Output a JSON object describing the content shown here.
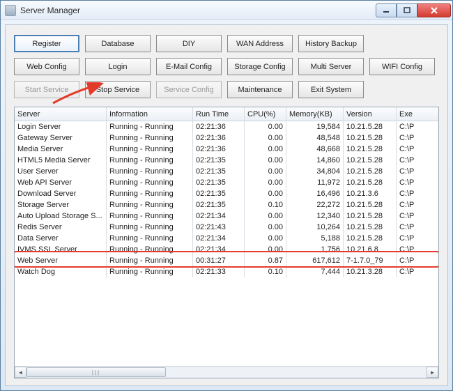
{
  "window": {
    "title": "Server Manager"
  },
  "buttons": {
    "row1": [
      "Register",
      "Database",
      "DIY",
      "WAN Address",
      "History Backup"
    ],
    "row2": [
      "Web Config",
      "Login",
      "E-Mail Config",
      "Storage Config",
      "Multi Server",
      "WIFI Config"
    ],
    "row3": [
      "Start Service",
      "Stop Service",
      "Service Config",
      "Maintenance",
      "Exit System"
    ]
  },
  "button_states": {
    "primary": [
      0
    ],
    "disabled_row3": [
      0,
      2
    ]
  },
  "table": {
    "headers": [
      "Server",
      "Information",
      "Run Time",
      "CPU(%)",
      "Memory(KB)",
      "Version",
      "Exe"
    ],
    "rows": [
      {
        "server": "Login Server",
        "info": "Running - Running",
        "runtime": "02:21:36",
        "cpu": "0.00",
        "mem": "19,584",
        "ver": "10.21.5.28",
        "exe": "C:\\P"
      },
      {
        "server": "Gateway Server",
        "info": "Running - Running",
        "runtime": "02:21:36",
        "cpu": "0.00",
        "mem": "48,548",
        "ver": "10.21.5.28",
        "exe": "C:\\P"
      },
      {
        "server": "Media Server",
        "info": "Running - Running",
        "runtime": "02:21:36",
        "cpu": "0.00",
        "mem": "48,668",
        "ver": "10.21.5.28",
        "exe": "C:\\P"
      },
      {
        "server": "HTML5 Media Server",
        "info": "Running - Running",
        "runtime": "02:21:35",
        "cpu": "0.00",
        "mem": "14,860",
        "ver": "10.21.5.28",
        "exe": "C:\\P"
      },
      {
        "server": "User Server",
        "info": "Running - Running",
        "runtime": "02:21:35",
        "cpu": "0.00",
        "mem": "34,804",
        "ver": "10.21.5.28",
        "exe": "C:\\P"
      },
      {
        "server": "Web API Server",
        "info": "Running - Running",
        "runtime": "02:21:35",
        "cpu": "0.00",
        "mem": "11,972",
        "ver": "10.21.5.28",
        "exe": "C:\\P"
      },
      {
        "server": "Download Server",
        "info": "Running - Running",
        "runtime": "02:21:35",
        "cpu": "0.00",
        "mem": "16,496",
        "ver": "10.21.3.6",
        "exe": "C:\\P"
      },
      {
        "server": "Storage Server",
        "info": "Running - Running",
        "runtime": "02:21:35",
        "cpu": "0.10",
        "mem": "22,272",
        "ver": "10.21.5.28",
        "exe": "C:\\P"
      },
      {
        "server": "Auto Upload Storage S...",
        "info": "Running - Running",
        "runtime": "02:21:34",
        "cpu": "0.00",
        "mem": "12,340",
        "ver": "10.21.5.28",
        "exe": "C:\\P"
      },
      {
        "server": "Redis Server",
        "info": "Running - Running",
        "runtime": "02:21:43",
        "cpu": "0.00",
        "mem": "10,264",
        "ver": "10.21.5.28",
        "exe": "C:\\P"
      },
      {
        "server": "Data Server",
        "info": "Running - Running",
        "runtime": "02:21:34",
        "cpu": "0.00",
        "mem": "5,188",
        "ver": "10.21.5.28",
        "exe": "C:\\P"
      },
      {
        "server": "IVMS SSL Server",
        "info": "Running - Running",
        "runtime": "02:21:34",
        "cpu": "0.00",
        "mem": "1,756",
        "ver": "10.21.6.8",
        "exe": "C:\\P"
      },
      {
        "server": "Web Server",
        "info": "Running - Running",
        "runtime": "00:31:27",
        "cpu": "0.87",
        "mem": "617,612",
        "ver": "7-1.7.0_79",
        "exe": "C:\\P"
      },
      {
        "server": "Watch Dog",
        "info": "Running - Running",
        "runtime": "02:21:33",
        "cpu": "0.10",
        "mem": "7,444",
        "ver": "10.21.3.28",
        "exe": "C:\\P"
      }
    ],
    "highlight_row": 12
  }
}
